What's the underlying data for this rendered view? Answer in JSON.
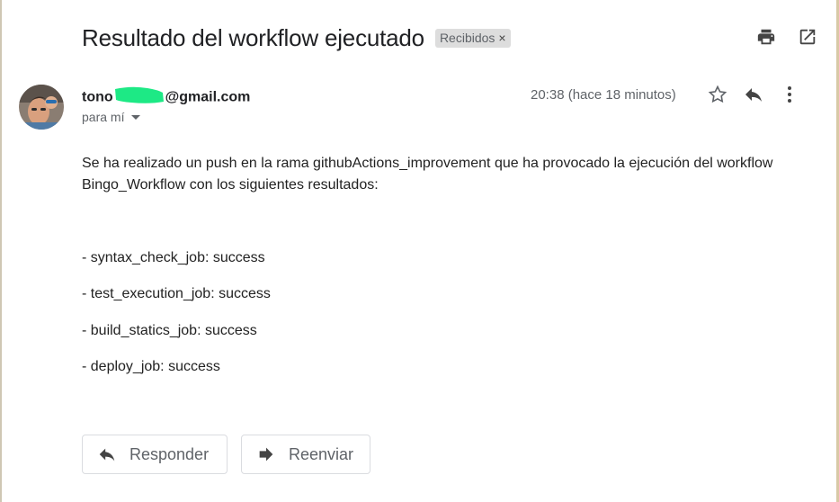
{
  "subject": "Resultado del workflow ejecutado",
  "label": {
    "text": "Recibidos",
    "close": "×"
  },
  "top_actions": {
    "print_icon": "print-icon",
    "open_new_window_icon": "open-in-new-window-icon"
  },
  "sender": {
    "email_prefix": "tono",
    "email_suffix": "@gmail.com",
    "to_label": "para mí"
  },
  "time": "20:38 (hace 18 minutos)",
  "message_actions": {
    "star_icon": "star-icon",
    "reply_icon": "reply-icon",
    "more_icon": "more-vert-icon"
  },
  "body": {
    "intro": "Se ha realizado un push en la rama githubActions_improvement que ha provocado la ejecución del workflow Bingo_Workflow con los siguientes resultados:",
    "results": [
      "- syntax_check_job: success",
      "- test_execution_job: success",
      "- build_statics_job: success",
      "- deploy_job: success"
    ]
  },
  "buttons": {
    "reply": "Responder",
    "forward": "Reenviar"
  },
  "colors": {
    "text": "#202124",
    "secondary": "#5f6368",
    "chip_bg": "#dddddd",
    "redact_marker": "#1de985"
  }
}
